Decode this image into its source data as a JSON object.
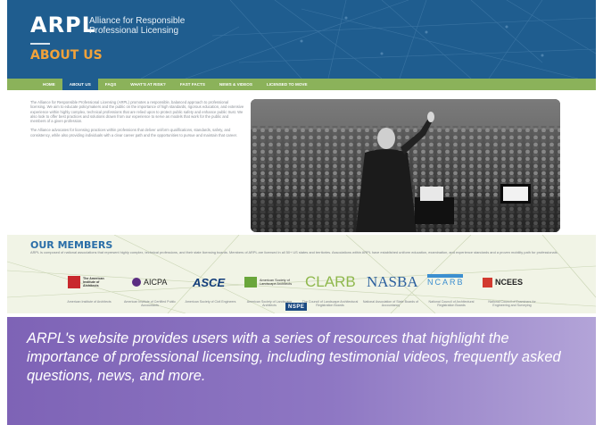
{
  "header": {
    "logo": "ARPL",
    "tagline": "Alliance for Responsible Professional Licensing",
    "page_title": "ABOUT US"
  },
  "nav": {
    "items": [
      "HOME",
      "ABOUT US",
      "FAQS",
      "WHAT'S AT RISK?",
      "FAST FACTS",
      "NEWS & VIDEOS",
      "LICENSED TO MOVE"
    ],
    "active": "ABOUT US"
  },
  "intro": {
    "paragraphs": [
      "The Alliance for Responsible Professional Licensing (ARPL) promotes a responsible, balanced approach to professional licensing. We aim to educate policymakers and the public on the importance of high standards, rigorous education, and extensive experience within highly complex, technical professions that are relied upon to protect public safety and enhance public trust. We also look to offer best practices and solutions drawn from our experience to serve as models that work for the public and members of a given profession.",
      "The Alliance advocates for licensing practices within professions that deliver uniform qualifications, standards, safety, and consistency, while also providing individuals with a clear career path and the opportunities to pursue and maintain that career."
    ]
  },
  "members": {
    "title": "OUR MEMBERS",
    "description": "ARPL is composed of national associations that represent highly complex, technical professions, and their state licensing boards. Members of ARPL are licensed in all 50+ US states and territories. Associations within ARPL have established uniform education, examination, and experience standards and a proven mobility path for professionals.",
    "logos": [
      {
        "text": "The American Institute of Architects",
        "name": "American Institute of Architects",
        "color": "#c8282d"
      },
      {
        "text": "AICPA",
        "name": "American Institute of Certified Public Accountants",
        "color": "#5b2d82"
      },
      {
        "text": "ASCE",
        "name": "American Society of Civil Engineers",
        "color": "#123d7a"
      },
      {
        "text": "American Society of Landscape Architects",
        "name": "American Society of Landscape Architects",
        "color": "#6aa63b"
      },
      {
        "text": "CLARB",
        "name": "The Council of Landscape Architectural Registration Boards",
        "color": "#8fb84d"
      },
      {
        "text": "NASBA",
        "name": "National Association of State Boards of Accountancy",
        "color": "#2b5f9e"
      },
      {
        "text": "NCARB",
        "name": "National Council of Architectural Registration Boards",
        "color": "#3c8fd0"
      },
      {
        "text": "NCEES",
        "name": "National Council of Examiners for Engineering and Surveying",
        "color": "#d23a2f"
      }
    ],
    "extra_logo": "NSPE"
  },
  "caption": {
    "text": "ARPL's website provides users with a series of resources that highlight the importance of professional licensing, including testimonial videos, frequently asked questions, news, and more."
  },
  "colors": {
    "header_blue": "#1f5d8f",
    "nav_green": "#8bb25a",
    "title_orange": "#f2a23a",
    "members_title_blue": "#2a6ea8",
    "caption_purple": "#8e77c3"
  }
}
